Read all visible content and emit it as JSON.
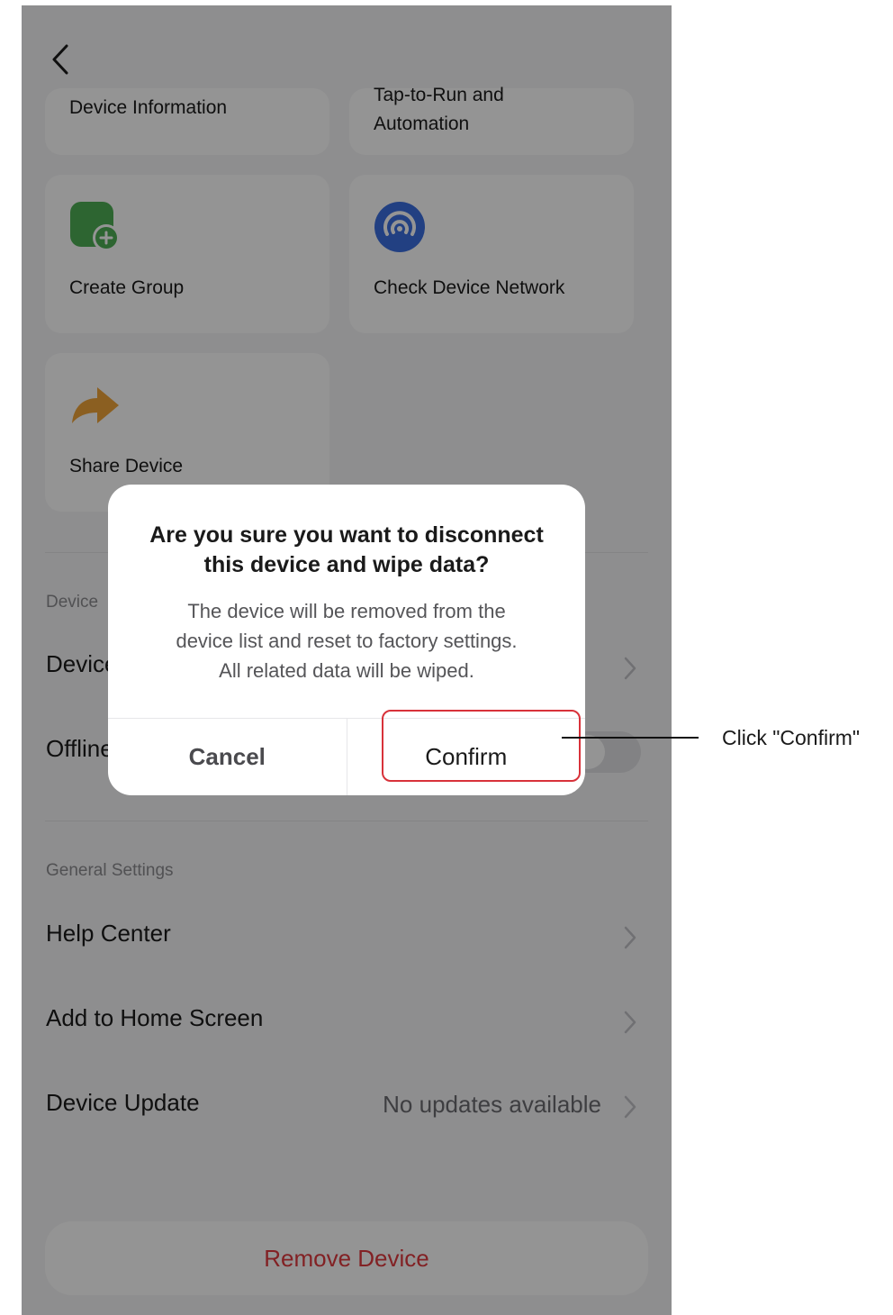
{
  "grid_cards": [
    {
      "label_lines": [
        "Device Information"
      ],
      "icon": "info-icon"
    },
    {
      "label_lines": [
        "Tap-to-Run and",
        "Automation"
      ],
      "icon": "automation-icon"
    },
    {
      "label_lines": [
        "Create Group"
      ],
      "icon": "create-group-icon",
      "color": "#4fae55"
    },
    {
      "label_lines": [
        "Check Device Network"
      ],
      "icon": "network-icon",
      "color": "#3b6fe0"
    },
    {
      "label_lines": [
        "Share Device"
      ],
      "icon": "share-arrow-icon",
      "color": "#f0a43a"
    }
  ],
  "sections": {
    "device": {
      "label": "Device",
      "rows": [
        {
          "label": "Device"
        },
        {
          "label": "Offline"
        }
      ]
    },
    "general": {
      "label": "General Settings",
      "rows": [
        {
          "label": "Help Center"
        },
        {
          "label": "Add to Home Screen"
        },
        {
          "label": "Device Update",
          "value": "No updates available"
        }
      ]
    }
  },
  "remove_button_label": "Remove Device",
  "dialog": {
    "title_lines": [
      "Are you sure you want to disconnect",
      "this device and wipe data?"
    ],
    "message_lines": [
      "The device will be removed from the",
      "device list and reset to factory settings.",
      "All related data will be wiped."
    ],
    "cancel_label": "Cancel",
    "confirm_label": "Confirm"
  },
  "annotation": {
    "text": "Click \"Confirm\"",
    "color": "#d8323a"
  }
}
